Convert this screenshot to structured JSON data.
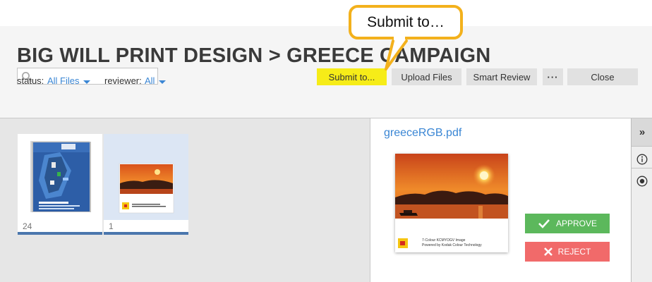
{
  "header": {
    "title": "BIG WILL PRINT DESIGN > GREECE CAMPAIGN"
  },
  "search": {
    "placeholder": "",
    "value": ""
  },
  "toolbar": {
    "submit_label": "Submit to...",
    "upload_label": "Upload Files",
    "smart_review_label": "Smart Review",
    "more_label": "···",
    "close_label": "Close"
  },
  "filters": {
    "status_label": "status:",
    "status_value": "All Files",
    "reviewer_label": "reviewer:",
    "reviewer_value": "All"
  },
  "thumbnails": [
    {
      "count": "24",
      "masthead": "BBB",
      "caption": "Be a smart factory",
      "sub": "Maximize automation & precision"
    },
    {
      "count": "1",
      "line1": "7-Colour KCMYOGV Image",
      "line2": "Powered by Kodak Colour Technology"
    }
  ],
  "detail": {
    "file_name": "greeceRGB.pdf",
    "preview_line1": "7-Colour KCMYOGV Image",
    "preview_line2": "Powered by Kodak Colour Technology",
    "approve_label": "APPROVE",
    "reject_label": "REJECT"
  },
  "rail": {
    "expand_label": "»"
  },
  "callout": {
    "text": "Submit to…"
  },
  "colors": {
    "accent_link": "#3a86d4",
    "submit_highlight": "#f6ec18",
    "approve": "#5cb85c",
    "reject": "#f16a6a",
    "callout_border": "#f3b11c"
  }
}
